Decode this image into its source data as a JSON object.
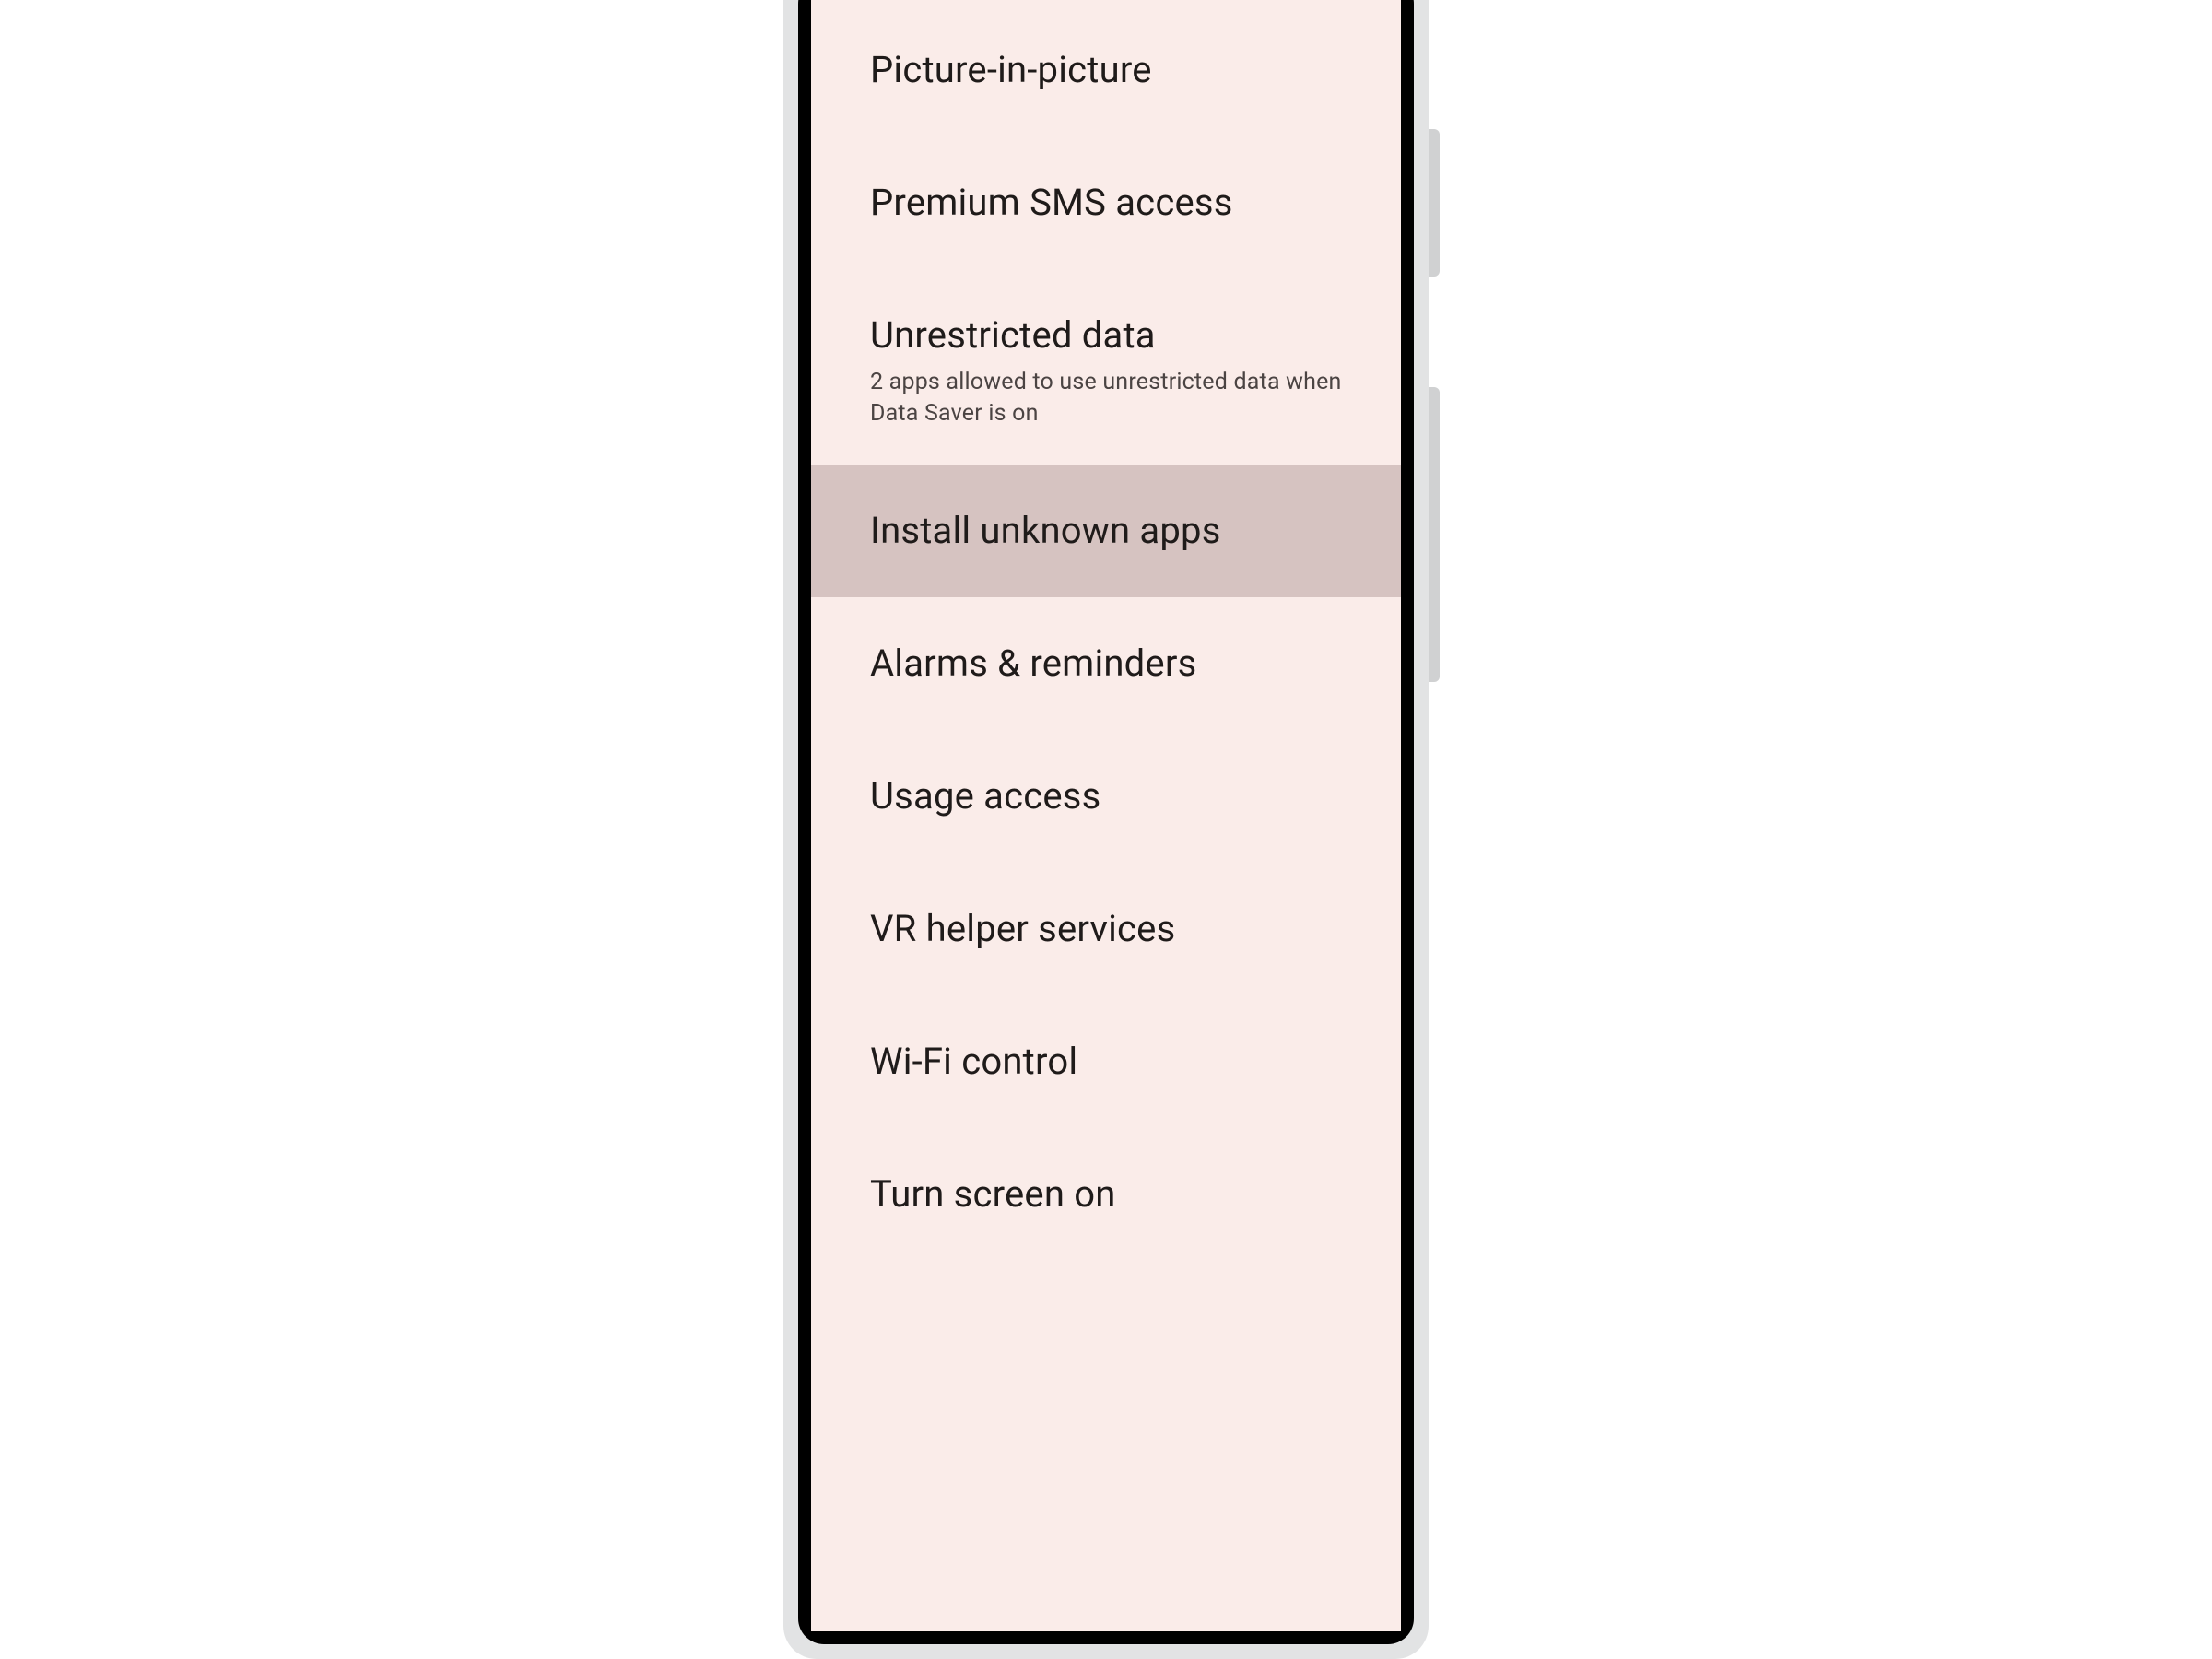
{
  "settings": {
    "items": [
      {
        "title": "Picture-in-picture",
        "subtitle": null,
        "highlight": false
      },
      {
        "title": "Premium SMS access",
        "subtitle": null,
        "highlight": false
      },
      {
        "title": "Unrestricted data",
        "subtitle": "2 apps allowed to use unrestricted data when Data Saver is on",
        "highlight": false
      },
      {
        "title": "Install unknown apps",
        "subtitle": null,
        "highlight": true
      },
      {
        "title": "Alarms & reminders",
        "subtitle": null,
        "highlight": false
      },
      {
        "title": "Usage access",
        "subtitle": null,
        "highlight": false
      },
      {
        "title": "VR helper services",
        "subtitle": null,
        "highlight": false
      },
      {
        "title": "Wi-Fi control",
        "subtitle": null,
        "highlight": false
      },
      {
        "title": "Turn screen on",
        "subtitle": null,
        "highlight": false
      }
    ]
  }
}
